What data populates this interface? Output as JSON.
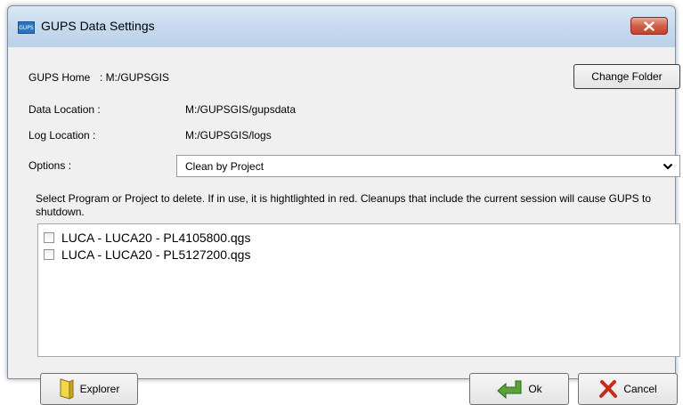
{
  "window": {
    "title": "GUPS Data Settings",
    "icon_text": "GUPS"
  },
  "settings": {
    "home_label": "GUPS Home",
    "home_value": ": M:/GUPSGIS",
    "change_folder_label": "Change Folder",
    "data_location_label": "Data Location  :",
    "data_location_value": "M:/GUPSGIS/gupsdata",
    "log_location_label": "Log Location  :",
    "log_location_value": "M:/GUPSGIS/logs",
    "options_label": "Options :",
    "options_selected": "Clean by Project"
  },
  "description": "Select Program or Project to delete. If in use, it is hightlighted in red. Cleanups that include the current session will cause GUPS to shutdown.",
  "list": {
    "items": [
      {
        "label": "LUCA - LUCA20 - PL4105800.qgs",
        "checked": false
      },
      {
        "label": "LUCA - LUCA20 - PL5127200.qgs",
        "checked": false
      }
    ]
  },
  "buttons": {
    "explorer": "Explorer",
    "ok": "Ok",
    "cancel": "Cancel"
  },
  "icons": {
    "app": "gups-app-icon",
    "close": "close-icon",
    "dropdown": "chevron-down-icon",
    "explorer": "folder-icon",
    "ok": "green-arrow-icon",
    "cancel": "red-x-icon"
  },
  "colors": {
    "title_bar": "#c6d9ee",
    "close_button": "#d15f48",
    "dialog_bg": "#f0f0f0"
  }
}
